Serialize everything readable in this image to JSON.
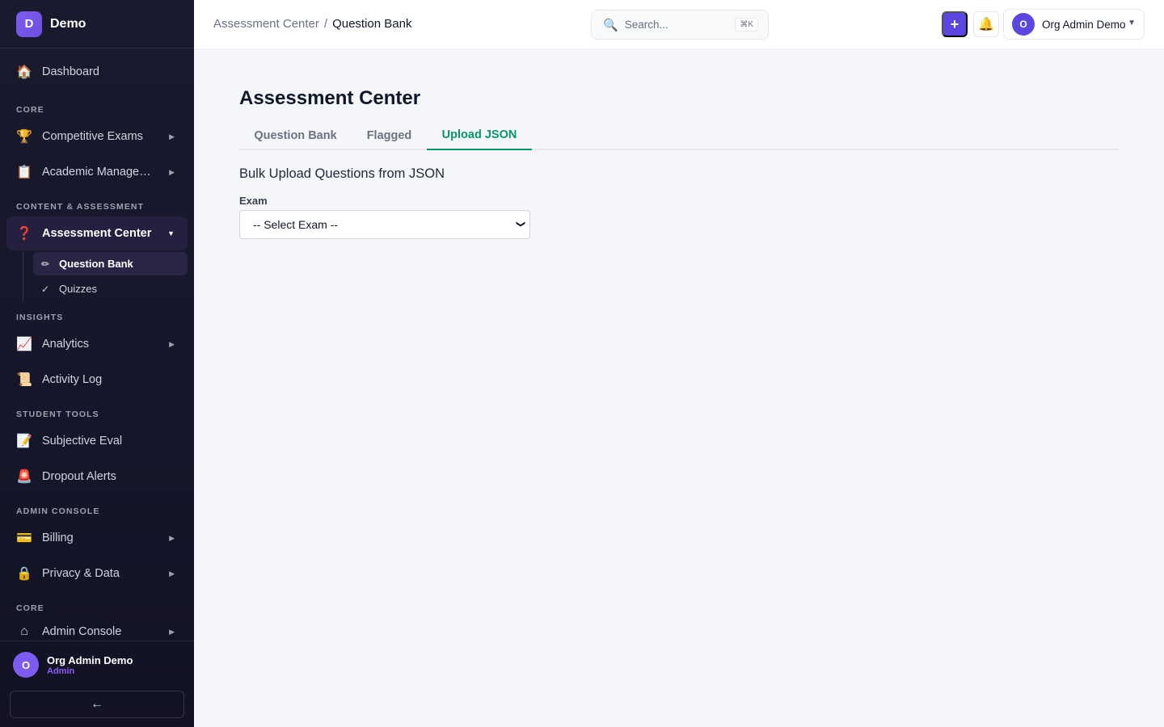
{
  "brand": {
    "logo_letter": "D",
    "name": "Demo"
  },
  "sidebar": {
    "dashboard": {
      "label": "Dashboard",
      "icon": "house-icon"
    },
    "sections": [
      "CORE",
      "CONTENT & ASSESSMENT",
      "INSIGHTS",
      "STUDENT TOOLS",
      "ADMIN CONSOLE",
      "CORE"
    ],
    "items": [
      {
        "label": "Competitive Exams",
        "icon": "trophy-icon",
        "has_caret": true
      },
      {
        "label": "Academic Management",
        "icon": "clipboard-icon",
        "has_caret": true
      },
      {
        "label": "Assessment Center",
        "icon": "question-mark-icon",
        "has_caret": true,
        "active": true
      },
      {
        "label": "Analytics",
        "icon": "chart-icon",
        "has_caret": true
      },
      {
        "label": "Activity Log",
        "icon": "scroll-icon",
        "has_caret": false
      },
      {
        "label": "Subjective Eval",
        "icon": "memo-icon",
        "has_caret": false
      },
      {
        "label": "Dropout Alerts",
        "icon": "siren-icon",
        "has_caret": false
      },
      {
        "label": "Billing",
        "icon": "credit-card-icon",
        "has_caret": true
      },
      {
        "label": "Privacy & Data",
        "icon": "lock-icon",
        "has_caret": true
      },
      {
        "label": "Admin Console",
        "icon": "home-outline-icon",
        "has_caret": true
      }
    ],
    "subitems": [
      {
        "label": "Question Bank",
        "icon": "pencil-icon",
        "active": true
      },
      {
        "label": "Quizzes",
        "icon": "check-icon",
        "active": false
      }
    ],
    "footer": {
      "avatar_letter": "O",
      "user_name": "Org Admin Demo",
      "user_role": "Admin",
      "collapse_label": "←"
    }
  },
  "topbar": {
    "breadcrumb": {
      "parent": "Assessment Center",
      "separator": "/",
      "current": "Question Bank"
    },
    "search": {
      "placeholder": "Search...",
      "shortcut": "⌘K"
    },
    "add_label": "+",
    "user": {
      "avatar_letter": "O",
      "name": "Org Admin Demo"
    }
  },
  "main": {
    "title": "Assessment Center",
    "tabs": [
      {
        "label": "Question Bank",
        "active": false
      },
      {
        "label": "Flagged",
        "active": false
      },
      {
        "label": "Upload JSON",
        "active": true
      }
    ],
    "section_title": "Bulk Upload Questions from JSON",
    "exam_label": "Exam",
    "exam_select_value": "-- Select Exam --"
  },
  "colors": {
    "accent": "#5b47e0",
    "tab_active": "#059669",
    "sidebar_bg": "#1a1a2e",
    "role_text": "#8b5cf6"
  }
}
